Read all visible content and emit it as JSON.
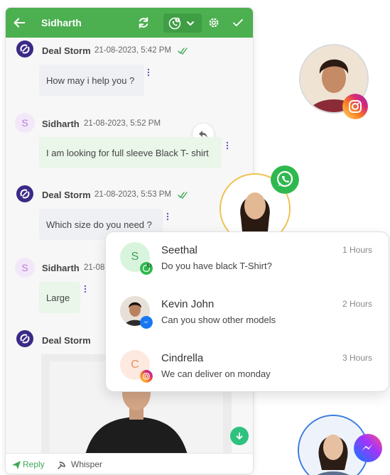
{
  "chat": {
    "contact_name": "Sidharth",
    "messages": [
      {
        "sender": "Deal Storm",
        "timestamp": "21-08-2023, 5:42 PM",
        "text": "How may i help you ?"
      },
      {
        "sender": "Sidharth",
        "avatar_letter": "S",
        "timestamp": "21-08-2023, 5:52 PM",
        "text": "I am looking for full sleeve Black T- shirt"
      },
      {
        "sender": "Deal Storm",
        "timestamp": "21-08-2023, 5:53 PM",
        "text": "Which size do you need ?"
      },
      {
        "sender": "Sidharth",
        "avatar_letter": "S",
        "timestamp": "21-08",
        "text": "Large"
      },
      {
        "sender": "Deal Storm"
      }
    ],
    "footer": {
      "reply_label": "Reply",
      "whisper_label": "Whisper"
    },
    "colors": {
      "header": "#4caf50",
      "accent": "#3b2a87",
      "reply_green": "#3fa85a"
    }
  },
  "conversations": [
    {
      "avatar_letter": "S",
      "name": "Seethal",
      "preview": "Do you have black T-Shirt?",
      "time": "1 Hours",
      "channel": "whatsapp-icon"
    },
    {
      "name": "Kevin John",
      "preview": "Can you show other models",
      "time": "2 Hours",
      "channel": "messenger-icon"
    },
    {
      "avatar_letter": "C",
      "name": "Cindrella",
      "preview": "We can deliver on monday",
      "time": "3 Hours",
      "channel": "instagram-icon"
    }
  ]
}
